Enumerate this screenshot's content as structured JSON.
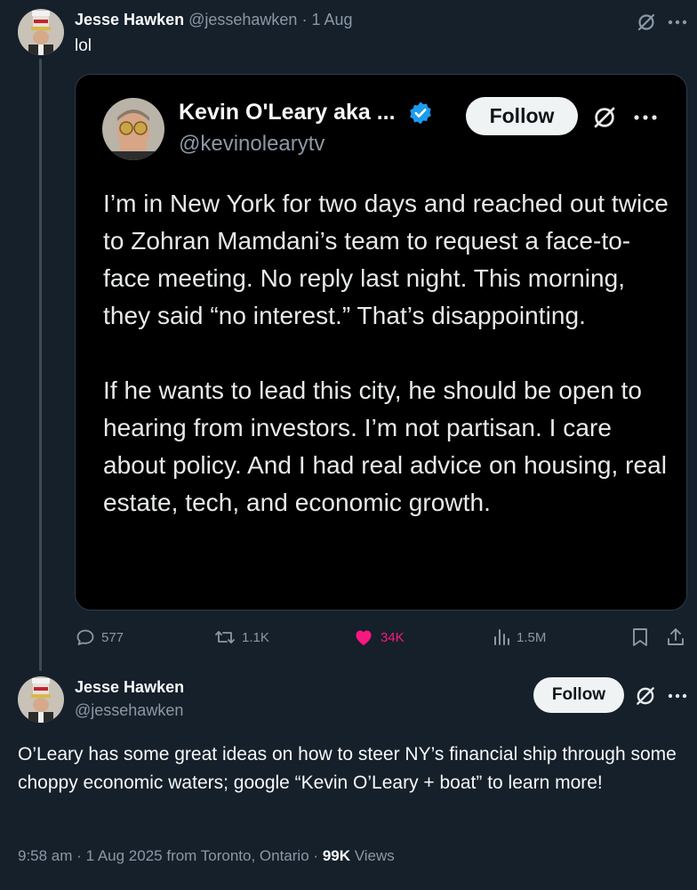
{
  "reply_tweet": {
    "author_name": "Jesse Hawken",
    "handle": "@jessehawken",
    "separator": "·",
    "date": "1 Aug",
    "text": "lol"
  },
  "quoted_tweet": {
    "author_name": "Kevin O'Leary aka ...",
    "handle": "@kevinolearytv",
    "verified": true,
    "follow_label": "Follow",
    "text": "I’m in New York for two days and reached out twice to Zohran Mamdani’s team to request a face-to-face meeting. No reply last night. This morning, they said “no interest.” That’s disappointing.\n\nIf he wants to lead this city, he should be open to hearing from investors. I’m not partisan. I care about policy. And I had real advice on housing, real estate, tech, and economic growth."
  },
  "actions": {
    "replies": "577",
    "reposts": "1.1K",
    "likes": "34K",
    "views": "1.5M",
    "liked": true
  },
  "main_tweet": {
    "author_name": "Jesse Hawken",
    "handle": "@jessehawken",
    "follow_label": "Follow",
    "text": "O’Leary has some great ideas on how to steer NY’s financial ship through some choppy economic waters; google “Kevin O’Leary + boat” to learn more!",
    "time": "9:58 am",
    "dot": "·",
    "date": "1 Aug 2025",
    "location": "from Toronto, Ontario",
    "views_count": "99K",
    "views_label": "Views"
  },
  "colors": {
    "background": "#15202b",
    "like_pink": "#f91880",
    "verified_blue": "#1d9bf0",
    "muted_text": "#8b98a5"
  },
  "icons": [
    "grok-icon",
    "more-icon",
    "verified-badge-icon",
    "reply-icon",
    "repost-icon",
    "heart-icon",
    "views-icon",
    "bookmark-icon",
    "share-icon"
  ]
}
